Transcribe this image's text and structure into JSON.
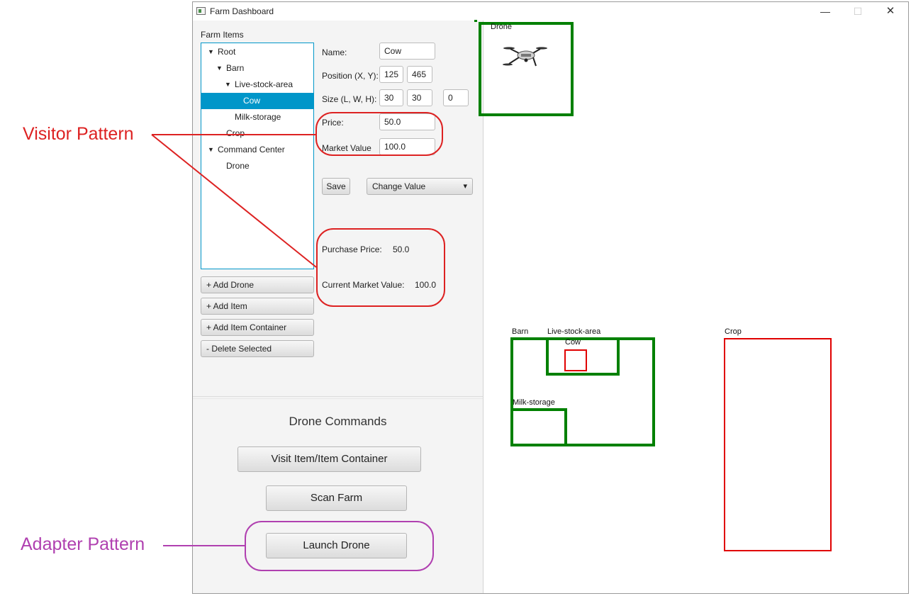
{
  "window": {
    "title": "Farm Dashboard",
    "minimize": "—",
    "maximize": "☐",
    "close": "✕"
  },
  "farm_items": {
    "label": "Farm Items",
    "tree": [
      {
        "label": "Root",
        "expanded": true,
        "selected": false
      },
      {
        "label": "Barn",
        "expanded": true,
        "selected": false
      },
      {
        "label": "Live-stock-area",
        "expanded": true,
        "selected": false
      },
      {
        "label": "Cow",
        "selected": true
      },
      {
        "label": "Milk-storage",
        "selected": false
      },
      {
        "label": "Crop",
        "selected": false
      },
      {
        "label": "Command Center",
        "expanded": true,
        "selected": false
      },
      {
        "label": "Drone",
        "selected": false
      }
    ],
    "arrow_glyph": "▼"
  },
  "form": {
    "name_label": "Name:",
    "name_value": "Cow",
    "position_label": "Position (X, Y):",
    "pos_x": "125",
    "pos_y": "465",
    "size_label": "Size (L, W, H):",
    "size_l": "30",
    "size_w": "30",
    "size_h": "0",
    "price_label": "Price:",
    "price_value": "50.0",
    "market_label": "Market Value",
    "market_value": "100.0",
    "save_label": "Save",
    "change_value_label": "Change Value",
    "dropdown_arrow": "▾"
  },
  "summary": {
    "purchase_label": "Purchase Price:",
    "purchase_value": "50.0",
    "current_label": "Current Market Value:",
    "current_value": "100.0"
  },
  "item_buttons": {
    "add_drone": "+ Add Drone",
    "add_item": "+ Add Item",
    "add_container": "+ Add Item Container",
    "delete": "- Delete Selected"
  },
  "drone_commands": {
    "title": "Drone Commands",
    "visit": "Visit Item/Item Container",
    "scan": "Scan Farm",
    "launch": "Launch Drone"
  },
  "canvas": {
    "drone": "Drone",
    "barn": "Barn",
    "livestock": "Live-stock-area",
    "cow": "Cow",
    "milk": "Milk-storage",
    "crop": "Crop"
  },
  "annotations": {
    "visitor": "Visitor Pattern",
    "adapter": "Adapter Pattern",
    "visitor_color": "#dd2222",
    "adapter_color": "#b040b0"
  },
  "colors": {
    "accent": "#0096c9",
    "container": "#008000",
    "item": "#e00000"
  }
}
